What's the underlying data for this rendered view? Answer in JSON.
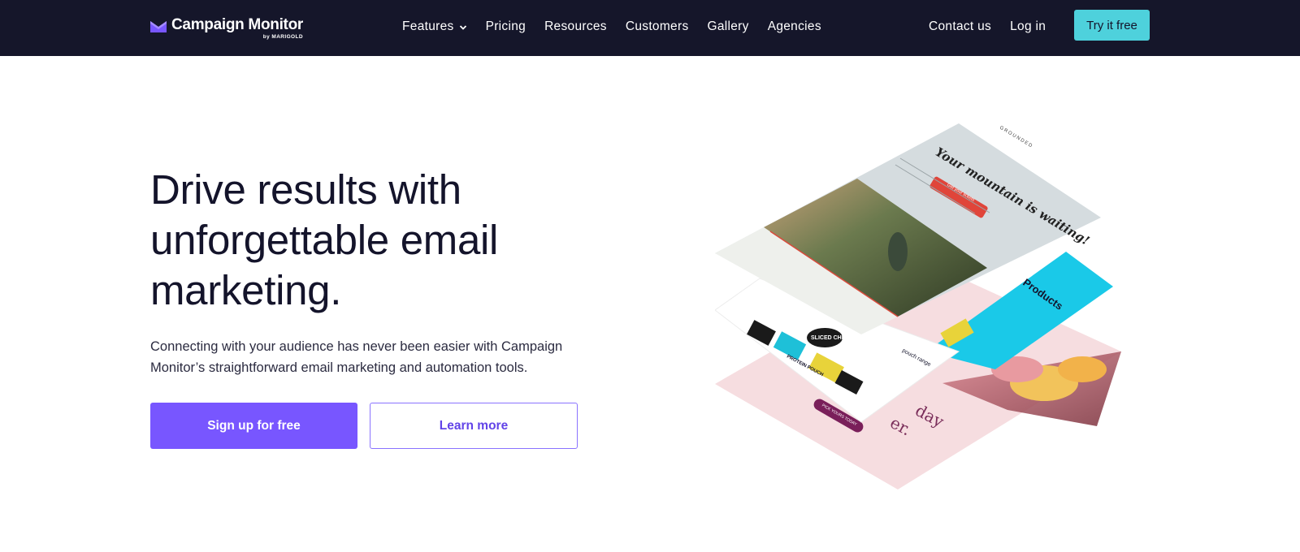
{
  "header": {
    "logo": {
      "name": "Campaign Monitor",
      "sub": "by MARIGOLD"
    },
    "nav_main": [
      {
        "label": "Features",
        "has_dropdown": true
      },
      {
        "label": "Pricing"
      },
      {
        "label": "Resources"
      },
      {
        "label": "Customers"
      },
      {
        "label": "Gallery"
      },
      {
        "label": "Agencies"
      }
    ],
    "nav_right": [
      {
        "label": "Contact us"
      },
      {
        "label": "Log in"
      }
    ],
    "cta_label": "Try it free"
  },
  "hero": {
    "title": "Drive results with unforgettable email marketing.",
    "subtitle": "Connecting with your audience has never been easier with Campaign Monitor’s straightforward email marketing and automation tools.",
    "primary_button": "Sign up for free",
    "secondary_button": "Learn more"
  },
  "illustration": {
    "brand": "GROUNDED",
    "headline": "Your mountain is waiting!",
    "cta": "Get your tickets",
    "products": "Products",
    "product_label_1": "SLICED CHICKEN",
    "product_label_2": "PROTEIN POUCH",
    "product_caption": "pouch range",
    "pink_text_1": "day",
    "pink_text_2": "er.",
    "pink_cta": "PICK YOURS TODAY"
  },
  "colors": {
    "topbar": "#15162a",
    "accent_cyan": "#4ed1dc",
    "primary_purple": "#7856ff",
    "heading": "#14142b"
  }
}
